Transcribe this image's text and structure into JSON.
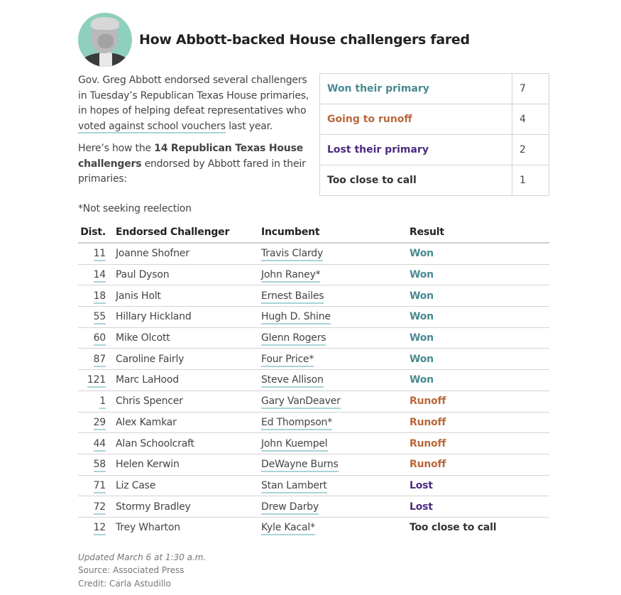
{
  "header": {
    "title": "How Abbott-backed House challengers fared",
    "avatar_alt": "Greg Abbott portrait"
  },
  "intro": {
    "p1_before": "Gov. Greg Abbott endorsed several challengers in Tuesday’s Republican Texas House primaries, in hopes of helping defeat representatives who ",
    "p1_link": "voted against school vouchers",
    "p1_after": " last year.",
    "p2_before": "Here’s how the ",
    "p2_bold": "14 Republican Texas House challengers",
    "p2_after": " endorsed by Abbott fared in their primaries:",
    "note": "*Not seeking reelection"
  },
  "colors": {
    "won": "#4a8a91",
    "runoff": "#b8683a",
    "lost": "#4b2a80",
    "close": "#333333",
    "underline": "#a9d4d8"
  },
  "summary": [
    {
      "label": "Won their primary",
      "value": "7",
      "status": "won"
    },
    {
      "label": "Going to runoff",
      "value": "4",
      "status": "runoff"
    },
    {
      "label": "Lost their primary",
      "value": "2",
      "status": "lost"
    },
    {
      "label": "Too close to call",
      "value": "1",
      "status": "close"
    }
  ],
  "table": {
    "headers": {
      "dist": "Dist.",
      "challenger": "Endorsed Challenger",
      "incumbent": "Incumbent",
      "result": "Result"
    },
    "rows": [
      {
        "dist": "11",
        "challenger": "Joanne Shofner",
        "incumbent": "Travis Clardy",
        "result": "Won",
        "status": "won"
      },
      {
        "dist": "14",
        "challenger": "Paul Dyson",
        "incumbent": "John Raney*",
        "result": "Won",
        "status": "won"
      },
      {
        "dist": "18",
        "challenger": "Janis Holt",
        "incumbent": "Ernest Bailes",
        "result": "Won",
        "status": "won"
      },
      {
        "dist": "55",
        "challenger": "Hillary Hickland",
        "incumbent": "Hugh D. Shine",
        "result": "Won",
        "status": "won"
      },
      {
        "dist": "60",
        "challenger": "Mike Olcott",
        "incumbent": "Glenn Rogers",
        "result": "Won",
        "status": "won"
      },
      {
        "dist": "87",
        "challenger": "Caroline Fairly",
        "incumbent": "Four Price*",
        "result": "Won",
        "status": "won"
      },
      {
        "dist": "121",
        "challenger": "Marc LaHood",
        "incumbent": "Steve Allison",
        "result": "Won",
        "status": "won"
      },
      {
        "dist": "1",
        "challenger": "Chris Spencer",
        "incumbent": "Gary VanDeaver",
        "result": "Runoff",
        "status": "runoff"
      },
      {
        "dist": "29",
        "challenger": "Alex Kamkar",
        "incumbent": "Ed Thompson*",
        "result": "Runoff",
        "status": "runoff"
      },
      {
        "dist": "44",
        "challenger": "Alan Schoolcraft",
        "incumbent": "John Kuempel",
        "result": "Runoff",
        "status": "runoff"
      },
      {
        "dist": "58",
        "challenger": "Helen Kerwin",
        "incumbent": "DeWayne Burns",
        "result": "Runoff",
        "status": "runoff"
      },
      {
        "dist": "71",
        "challenger": "Liz Case",
        "incumbent": "Stan Lambert",
        "result": "Lost",
        "status": "lost"
      },
      {
        "dist": "72",
        "challenger": "Stormy Bradley",
        "incumbent": "Drew Darby",
        "result": "Lost",
        "status": "lost"
      },
      {
        "dist": "12",
        "challenger": "Trey Wharton",
        "incumbent": "Kyle Kacal*",
        "result": "Too close to call",
        "status": "close"
      }
    ]
  },
  "footer": {
    "updated": "Updated March 6 at 1:30 a.m.",
    "source": "Source: Associated Press",
    "credit": "Credit: Carla Astudillo"
  }
}
